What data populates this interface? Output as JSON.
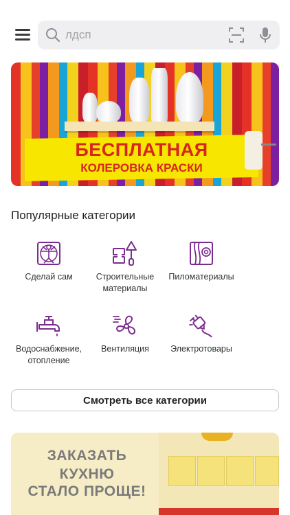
{
  "search": {
    "placeholder": "лдсп"
  },
  "banner_top": {
    "line1": "БЕСПЛАТНАЯ",
    "line2": "КОЛЕРОВКА КРАСКИ"
  },
  "popular": {
    "title": "Популярные категории",
    "categories": [
      {
        "label": "Сделай сам",
        "icon": "diy-icon"
      },
      {
        "label": "Строительные материалы",
        "icon": "building-materials-icon"
      },
      {
        "label": "Пиломатериалы",
        "icon": "lumber-icon"
      },
      {
        "label": "Водоснабжение, отопление",
        "icon": "water-tap-icon"
      },
      {
        "label": "Вентиляция",
        "icon": "fan-icon"
      },
      {
        "label": "Электротовары",
        "icon": "electric-plug-icon"
      }
    ],
    "view_all": "Смотреть все категории"
  },
  "banner_bottom": {
    "line1": "ЗАКАЗАТЬ",
    "line2": "КУХНЮ",
    "line3": "СТАЛО ПРОЩЕ!"
  },
  "colors": {
    "accent": "#7b2c8f",
    "search_bg": "#efeff1",
    "banner_red": "#d8251e",
    "banner_yellow": "#f6e600"
  }
}
